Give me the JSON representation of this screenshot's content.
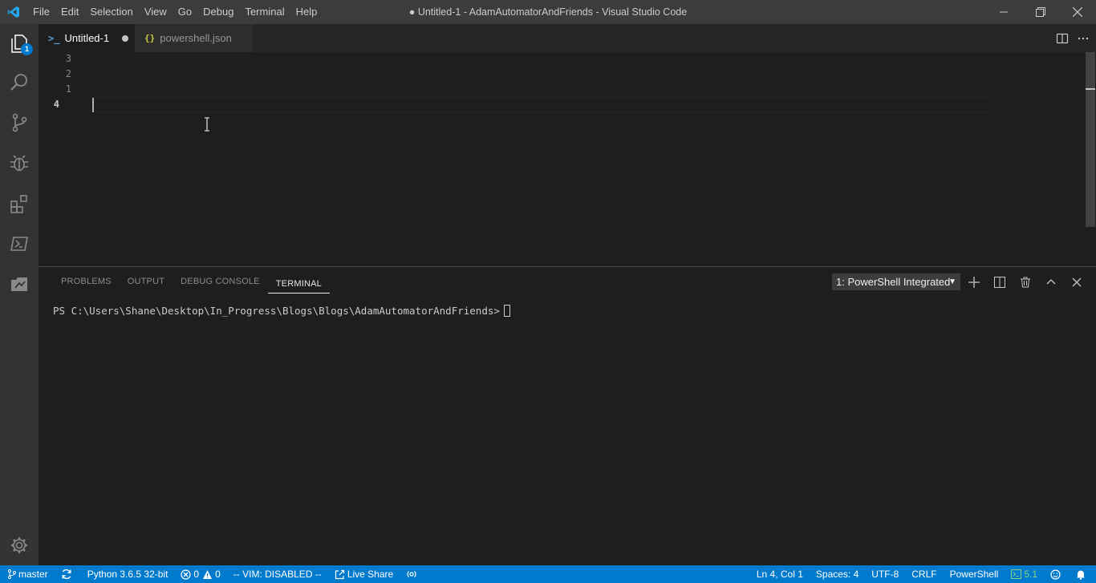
{
  "menubar": {
    "items": [
      "File",
      "Edit",
      "Selection",
      "View",
      "Go",
      "Debug",
      "Terminal",
      "Help"
    ]
  },
  "window": {
    "title": "● Untitled-1 - AdamAutomatorAndFriends - Visual Studio Code"
  },
  "activitybar": {
    "explorer_badge": "1"
  },
  "tabs": [
    {
      "label": "Untitled-1",
      "icon": "powershell-icon",
      "dirty": true,
      "active": true
    },
    {
      "label": "powershell.json",
      "icon": "json-braces-icon",
      "dirty": false,
      "active": false
    }
  ],
  "editor": {
    "line_numbers": [
      "3",
      "2",
      "1",
      "4"
    ]
  },
  "panel": {
    "tabs": [
      "PROBLEMS",
      "OUTPUT",
      "DEBUG CONSOLE",
      "TERMINAL"
    ],
    "terminal_select": "1: PowerShell Integrated",
    "prompt": "PS C:\\Users\\Shane\\Desktop\\In_Progress\\Blogs\\Blogs\\AdamAutomatorAndFriends>"
  },
  "statusbar": {
    "branch": "master",
    "python": "Python 3.6.5 32-bit",
    "errors": "0",
    "warnings": "0",
    "vim": "-- VIM: DISABLED --",
    "live_share": "Live Share",
    "position": "Ln 4, Col 1",
    "spaces": "Spaces: 4",
    "encoding": "UTF-8",
    "eol": "CRLF",
    "language": "PowerShell",
    "ps_version": "5.1"
  },
  "colors": {
    "accent": "#007acc",
    "titlebar": "#3c3c3c",
    "activitybar": "#333333",
    "editor_bg": "#1e1e1e",
    "ps_green": "#89d185"
  }
}
